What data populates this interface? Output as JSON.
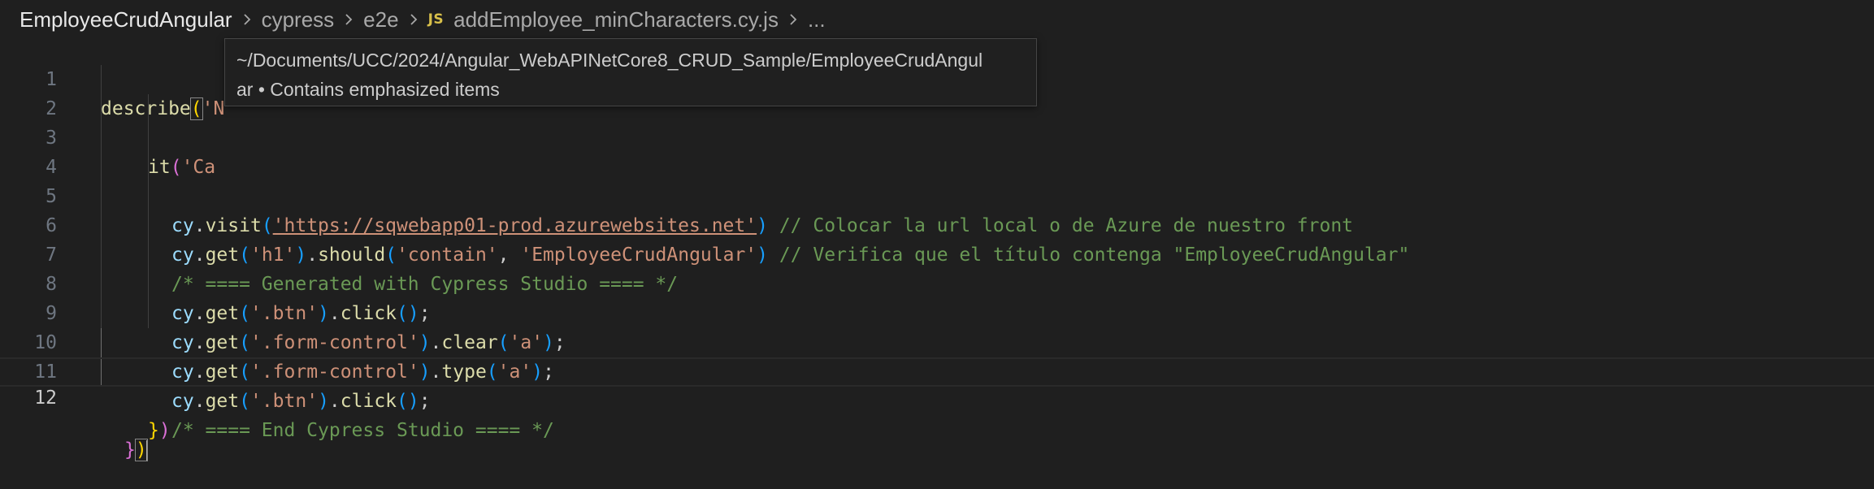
{
  "breadcrumb": {
    "items": [
      "EmployeeCrudAngular",
      "cypress",
      "e2e"
    ],
    "file_badge": "JS",
    "file_name": "addEmployee_minCharacters.cy.js",
    "ellipsis": "..."
  },
  "tooltip": {
    "line1": "~/Documents/UCC/2024/Angular_WebAPINetCore8_CRUD_Sample/EmployeeCrudAngul",
    "line2": "ar • Contains emphasized items"
  },
  "editor": {
    "line_numbers": [
      "1",
      "2",
      "3",
      "4",
      "5",
      "6",
      "7",
      "8",
      "9",
      "10",
      "11",
      "12"
    ],
    "l1": {
      "describe": "describe",
      "open": "(",
      "str": "'N"
    },
    "l2": {
      "it": "it",
      "open": "(",
      "str": "'Ca"
    },
    "l3": {
      "cy": "cy",
      "dot": ".",
      "fn": "visit",
      "open": "(",
      "url": "'https://sqwebapp01-prod.azurewebsites.net'",
      "close": ")",
      "comment": " // Colocar la url local o de Azure de nuestro front"
    },
    "l4": {
      "cy": "cy",
      "dot": ".",
      "fn": "get",
      "open": "(",
      "arg": "'h1'",
      "close": ")",
      "dot2": ".",
      "fn2": "should",
      "open2": "(",
      "arg2": "'contain'",
      "comma": ", ",
      "arg3": "'EmployeeCrudAngular'",
      "close2": ")",
      "comment": " // Verifica que el título contenga \"EmployeeCrudAngular\""
    },
    "l5": {
      "comment": "/* ==== Generated with Cypress Studio ==== */"
    },
    "l6": {
      "cy": "cy",
      "dot": ".",
      "fn": "get",
      "open": "(",
      "arg": "'.btn'",
      "close": ")",
      "dot2": ".",
      "fn2": "click",
      "paren": "()",
      "semi": ";"
    },
    "l7": {
      "cy": "cy",
      "dot": ".",
      "fn": "get",
      "open": "(",
      "arg": "'.form-control'",
      "close": ")",
      "dot2": ".",
      "fn2": "clear",
      "open2": "(",
      "arg2": "'a'",
      "close2": ")",
      "semi": ";"
    },
    "l8": {
      "cy": "cy",
      "dot": ".",
      "fn": "get",
      "open": "(",
      "arg": "'.form-control'",
      "close": ")",
      "dot2": ".",
      "fn2": "type",
      "open2": "(",
      "arg2": "'a'",
      "close2": ")",
      "semi": ";"
    },
    "l9": {
      "cy": "cy",
      "dot": ".",
      "fn": "get",
      "open": "(",
      "arg": "'.btn'",
      "close": ")",
      "dot2": ".",
      "fn2": "click",
      "paren": "()",
      "semi": ";"
    },
    "l10": {
      "comment": "/* ==== End Cypress Studio ==== */"
    },
    "l11": {
      "brace": "}",
      "paren": ")"
    },
    "l12": {
      "brace": "}",
      "paren": ")"
    }
  },
  "colors": {
    "background": "#1f1f1f",
    "function": "#dcdcaa",
    "variable": "#9cdcfe",
    "string": "#ce9178",
    "comment": "#6a9955",
    "bracket_level1": "#ffd700",
    "bracket_level2": "#da70d6",
    "bracket_level3": "#179fff"
  },
  "icons": [
    "chevron-right-icon",
    "javascript-file-icon"
  ]
}
